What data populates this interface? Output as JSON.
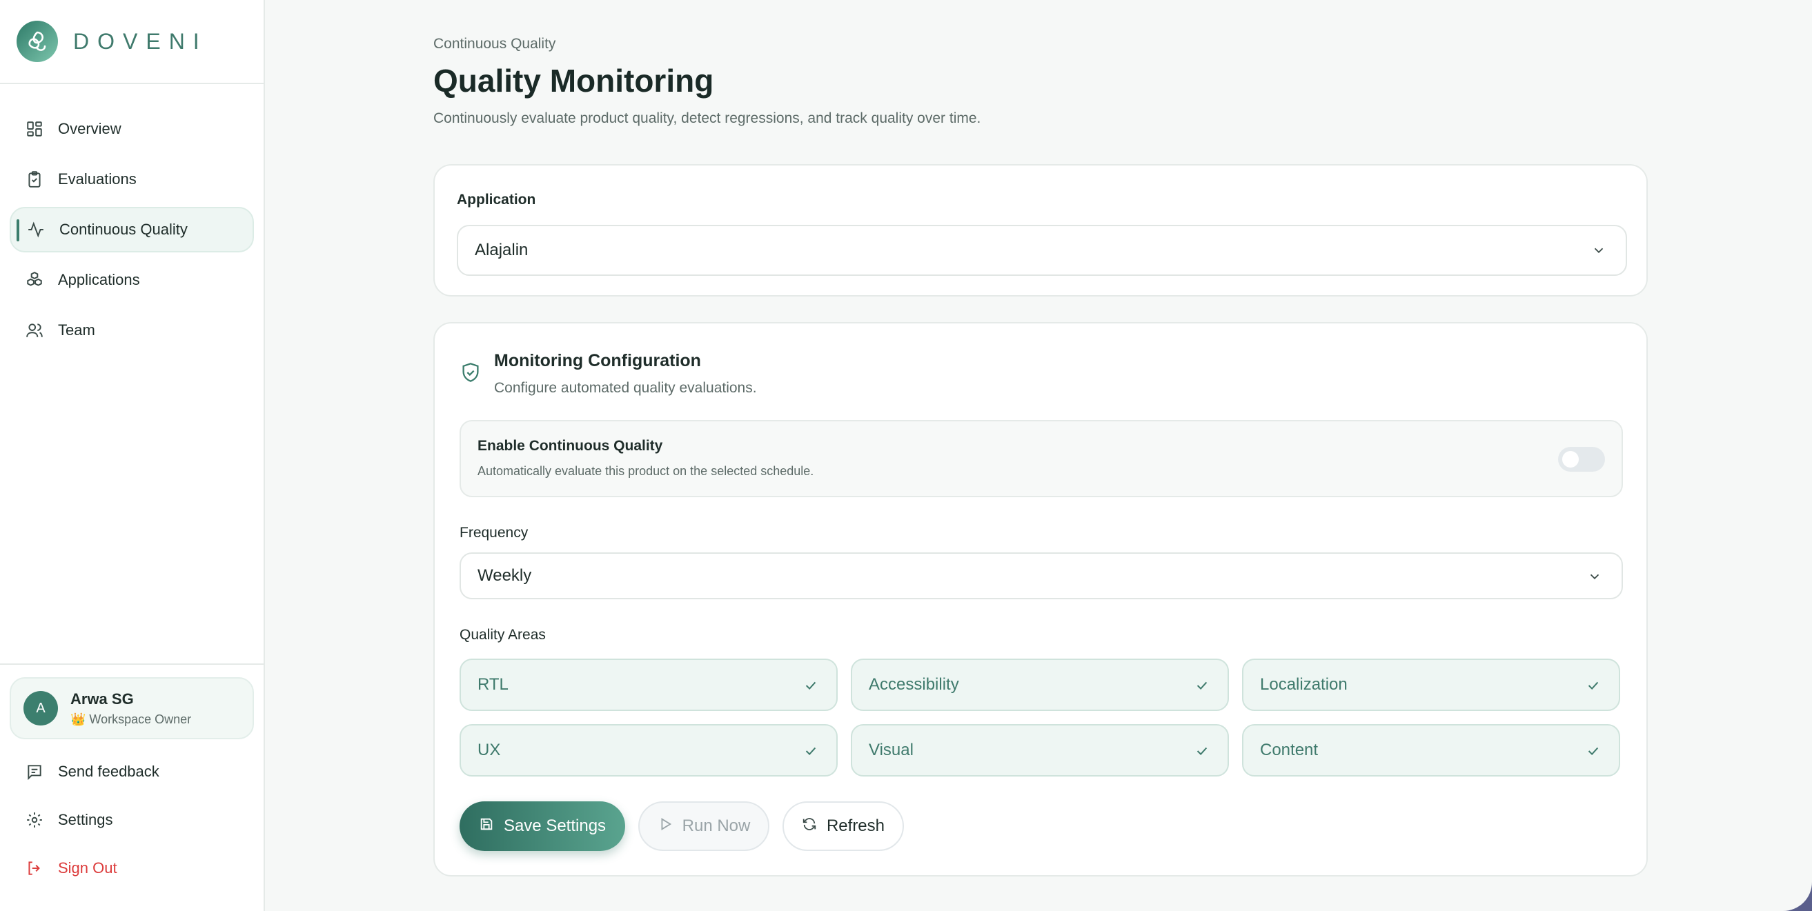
{
  "brand": {
    "name": "DOVENI"
  },
  "nav": {
    "items": [
      {
        "label": "Overview",
        "icon": "grid-icon"
      },
      {
        "label": "Evaluations",
        "icon": "clipboard-check-icon"
      },
      {
        "label": "Continuous Quality",
        "icon": "activity-icon",
        "active": true
      },
      {
        "label": "Applications",
        "icon": "boxes-icon"
      },
      {
        "label": "Team",
        "icon": "users-icon"
      }
    ]
  },
  "user": {
    "initial": "A",
    "name": "Arwa SG",
    "role": "👑 Workspace Owner"
  },
  "bottom_nav": {
    "feedback": "Send feedback",
    "settings": "Settings",
    "signout": "Sign Out"
  },
  "header": {
    "breadcrumb": "Continuous Quality",
    "title": "Quality Monitoring",
    "subtitle": "Continuously evaluate product quality, detect regressions, and track quality over time."
  },
  "application": {
    "label": "Application",
    "value": "Alajalin"
  },
  "monitoring": {
    "title": "Monitoring Configuration",
    "subtitle": "Configure automated quality evaluations.",
    "enable": {
      "title": "Enable Continuous Quality",
      "subtitle": "Automatically evaluate this product on the selected schedule.",
      "on": false
    },
    "frequency": {
      "label": "Frequency",
      "value": "Weekly"
    },
    "areas_label": "Quality Areas",
    "areas": [
      "RTL",
      "Accessibility",
      "Localization",
      "UX",
      "Visual",
      "Content"
    ]
  },
  "actions": {
    "save": "Save Settings",
    "run": "Run Now",
    "refresh": "Refresh"
  },
  "colors": {
    "accent": "#3b7d6c",
    "danger": "#dc3b3b",
    "chip_bg": "#eef6f3"
  }
}
